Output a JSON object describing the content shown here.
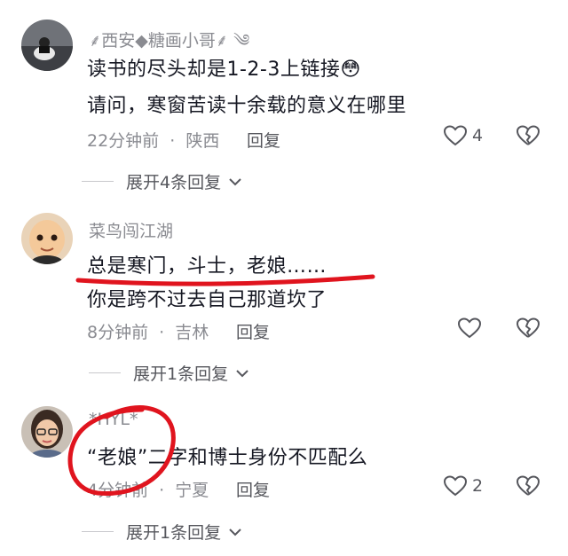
{
  "comments": [
    {
      "username": "⸙西安◆糖画小哥⸙ ༄",
      "lines": [
        "读书的尽头却是1-2-3上链接😳",
        "请问，寒窗苦读十余载的意义在哪里"
      ],
      "time": "22分钟前",
      "location": "陕西",
      "reply_label": "回复",
      "likes": "4",
      "expand_label": "展开4条回复"
    },
    {
      "username": "菜鸟闯江湖",
      "lines": [
        "总是寒门，斗士，老娘……",
        "你是跨不过去自己那道坎了"
      ],
      "time": "8分钟前",
      "location": "吉林",
      "reply_label": "回复",
      "likes": "",
      "expand_label": "展开1条回复"
    },
    {
      "username": "*HYL*",
      "lines": [
        "“老娘”二字和博士身份不匹配么"
      ],
      "time": "4分钟前",
      "location": "宁夏",
      "reply_label": "回复",
      "likes": "2",
      "expand_label": "展开1条回复"
    }
  ],
  "separator": "·",
  "annotation_color": "#e0141e"
}
